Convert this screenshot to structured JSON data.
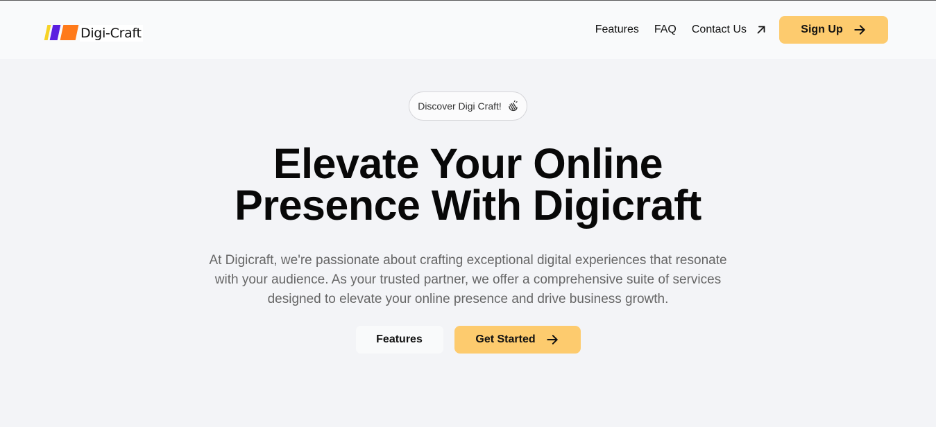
{
  "brand": {
    "name": "Digi-Craft"
  },
  "nav": {
    "links": [
      "Features",
      "FAQ",
      "Contact Us"
    ],
    "signup_label": "Sign Up"
  },
  "hero": {
    "badge": "Discover Digi Craft!",
    "headline_line1": "Elevate Your Online",
    "headline_line2": "Presence With Digicraft",
    "description": "At Digicraft, we're passionate about crafting exceptional digital experiences that resonate with your audience. As your trusted partner, we offer a comprehensive suite of services designed to elevate your online presence and drive business growth.",
    "secondary_button": "Features",
    "primary_button": "Get Started"
  },
  "colors": {
    "accent": "#fdcb6e",
    "background": "#f3f4f7",
    "nav_background": "#f9fafb"
  },
  "icons": [
    "arrow-up-right-icon",
    "arrow-right-icon",
    "clapping-hands-icon"
  ]
}
